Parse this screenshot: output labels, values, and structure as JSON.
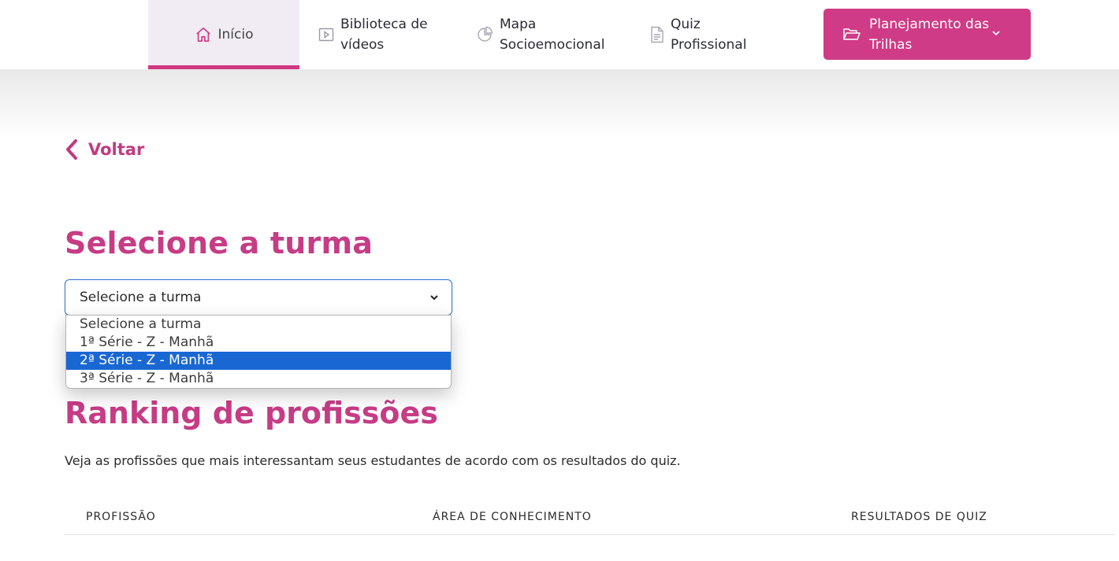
{
  "nav": {
    "home": {
      "label": "Início",
      "icon": "home-icon"
    },
    "library": {
      "line1": "Biblioteca de",
      "line2": "vídeos",
      "icon": "play-icon"
    },
    "map": {
      "line1": "Mapa",
      "line2": "Socioemocional",
      "icon": "pie-chart-icon"
    },
    "quiz": {
      "line1": "Quiz",
      "line2": "Profissional",
      "icon": "document-icon"
    },
    "planning": {
      "line1": "Planejamento",
      "line2": "das Trilhas",
      "icon": "folder-open-icon"
    }
  },
  "back": {
    "label": "Voltar"
  },
  "select_section": {
    "title": "Selecione a turma",
    "current_value": "Selecione a turma",
    "options": [
      "Selecione a turma",
      "1ª Série - Z - Manhã",
      "2ª Série - Z - Manhã",
      "3ª Série - Z - Manhã"
    ],
    "highlighted_option": "2ª Série - Z - Manhã"
  },
  "ranking": {
    "title": "Ranking de profissões",
    "description": "Veja as profissões que mais interessantam seus estudantes de acordo com os resultados do quiz.",
    "columns": [
      "PROFISSÃO",
      "ÁREA DE CONHECIMENTO",
      "RESULTADOS DE QUIZ"
    ]
  },
  "colors": {
    "accent": "#cf3b86",
    "heading": "#c63c85",
    "select_border": "#2e6fcf",
    "option_highlight": "#1967d2"
  }
}
